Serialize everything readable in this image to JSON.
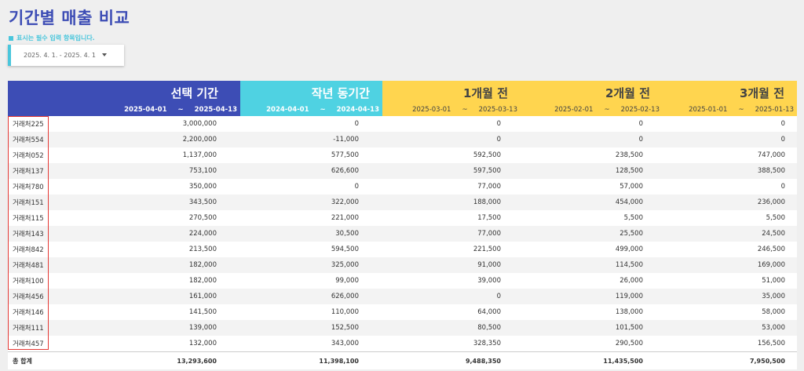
{
  "page": {
    "title": "기간별 매출 비교",
    "required_note": "표시는 필수 입력 항목입니다.",
    "date_range": "2025. 4. 1. - 2025. 4. 1"
  },
  "columns": [
    {
      "title": "선택 기간",
      "start": "2025-04-01",
      "sep": "~",
      "end": "2025-04-13"
    },
    {
      "title": "작년 동기간",
      "start": "2024-04-01",
      "sep": "~",
      "end": "2024-04-13"
    },
    {
      "title": "1개월 전",
      "start": "2025-03-01",
      "sep": "~",
      "end": "2025-03-13"
    },
    {
      "title": "2개월 전",
      "start": "2025-02-01",
      "sep": "~",
      "end": "2025-02-13"
    },
    {
      "title": "3개월 전",
      "start": "2025-01-01",
      "sep": "~",
      "end": "2025-01-13"
    }
  ],
  "rows": [
    {
      "name": "거래처225",
      "v": [
        "3,000,000",
        "0",
        "0",
        "0",
        "0"
      ]
    },
    {
      "name": "거래처554",
      "v": [
        "2,200,000",
        "-11,000",
        "0",
        "0",
        "0"
      ]
    },
    {
      "name": "거래처052",
      "v": [
        "1,137,000",
        "577,500",
        "592,500",
        "238,500",
        "747,000"
      ]
    },
    {
      "name": "거래처137",
      "v": [
        "753,100",
        "626,600",
        "597,500",
        "128,500",
        "388,500"
      ]
    },
    {
      "name": "거래처780",
      "v": [
        "350,000",
        "0",
        "77,000",
        "57,000",
        "0"
      ]
    },
    {
      "name": "거래처151",
      "v": [
        "343,500",
        "322,000",
        "188,000",
        "454,000",
        "236,000"
      ]
    },
    {
      "name": "거래처115",
      "v": [
        "270,500",
        "221,000",
        "17,500",
        "5,500",
        "5,500"
      ]
    },
    {
      "name": "거래처143",
      "v": [
        "224,000",
        "30,500",
        "77,000",
        "25,500",
        "24,500"
      ]
    },
    {
      "name": "거래처842",
      "v": [
        "213,500",
        "594,500",
        "221,500",
        "499,000",
        "246,500"
      ]
    },
    {
      "name": "거래처481",
      "v": [
        "182,000",
        "325,000",
        "91,000",
        "114,500",
        "169,000"
      ]
    },
    {
      "name": "거래처100",
      "v": [
        "182,000",
        "99,000",
        "39,000",
        "26,000",
        "51,000"
      ]
    },
    {
      "name": "거래처456",
      "v": [
        "161,000",
        "626,000",
        "0",
        "119,000",
        "35,000"
      ]
    },
    {
      "name": "거래처146",
      "v": [
        "141,500",
        "110,000",
        "64,000",
        "138,000",
        "58,000"
      ]
    },
    {
      "name": "거래처111",
      "v": [
        "139,000",
        "152,500",
        "80,500",
        "101,500",
        "53,000"
      ]
    },
    {
      "name": "거래처457",
      "v": [
        "132,000",
        "343,000",
        "328,350",
        "290,500",
        "156,500"
      ]
    }
  ],
  "total": {
    "name": "총 합계",
    "v": [
      "13,293,600",
      "11,398,100",
      "9,488,350",
      "11,435,500",
      "7,950,500"
    ]
  },
  "colors": {
    "primary": "#3d4db5",
    "cyan": "#4fd2e2",
    "yellow": "#ffd54f",
    "highlight": "#e53935"
  }
}
